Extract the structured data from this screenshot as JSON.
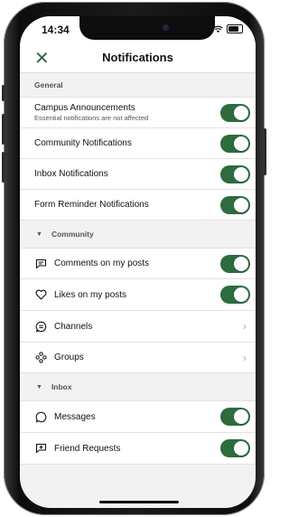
{
  "status_bar": {
    "time": "14:34"
  },
  "header": {
    "title": "Notifications",
    "close_glyph": "✕"
  },
  "colors": {
    "accent": "#2e6b3e"
  },
  "general": {
    "label": "General",
    "items": [
      {
        "label": "Campus Announcements",
        "sub": "Essential notifications are not affected",
        "on": true
      },
      {
        "label": "Community Notifications",
        "on": true
      },
      {
        "label": "Inbox Notifications",
        "on": true
      },
      {
        "label": "Form Reminder Notifications",
        "on": true
      }
    ]
  },
  "community": {
    "label": "Community",
    "items": [
      {
        "label": "Comments on my posts",
        "icon": "comment-icon",
        "on": true
      },
      {
        "label": "Likes on my posts",
        "icon": "heart-icon",
        "on": true
      },
      {
        "label": "Channels",
        "icon": "channels-icon",
        "chevron": true
      },
      {
        "label": "Groups",
        "icon": "groups-icon",
        "chevron": true
      }
    ]
  },
  "inbox": {
    "label": "Inbox",
    "items": [
      {
        "label": "Messages",
        "icon": "message-icon",
        "on": true
      },
      {
        "label": "Friend Requests",
        "icon": "friend-request-icon",
        "on": true
      }
    ]
  }
}
